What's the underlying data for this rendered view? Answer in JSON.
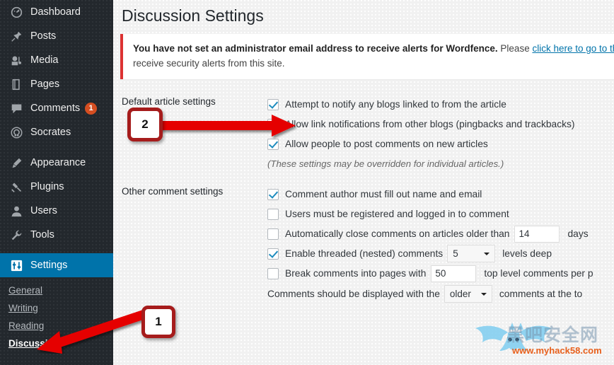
{
  "sidebar": {
    "items": [
      {
        "label": "Dashboard",
        "icon": "dashboard-icon",
        "name": "dashboard"
      },
      {
        "label": "Posts",
        "icon": "pin-icon",
        "name": "posts"
      },
      {
        "label": "Media",
        "icon": "media-icon",
        "name": "media"
      },
      {
        "label": "Pages",
        "icon": "pages-icon",
        "name": "pages"
      },
      {
        "label": "Comments",
        "icon": "comment-bubble-icon",
        "name": "comments",
        "badge": "1"
      },
      {
        "label": "Socrates",
        "icon": "omega-icon",
        "name": "socrates"
      },
      {
        "label": "Appearance",
        "icon": "brush-icon",
        "name": "appearance"
      },
      {
        "label": "Plugins",
        "icon": "plug-icon",
        "name": "plugins"
      },
      {
        "label": "Users",
        "icon": "user-icon",
        "name": "users"
      },
      {
        "label": "Tools",
        "icon": "wrench-icon",
        "name": "tools"
      },
      {
        "label": "Settings",
        "icon": "settings-sliders-icon",
        "name": "settings",
        "active": true
      }
    ],
    "submenu": [
      {
        "label": "General",
        "name": "general"
      },
      {
        "label": "Writing",
        "name": "writing"
      },
      {
        "label": "Reading",
        "name": "reading"
      },
      {
        "label": "Discussion",
        "name": "discussion",
        "current": true
      }
    ]
  },
  "page": {
    "title": "Discussion Settings"
  },
  "notice": {
    "bold_text": "You have not set an administrator email address to receive alerts for Wordfence.",
    "text_before_link": " Please ",
    "link_text": "click here to go to th",
    "text_after": "receive security alerts from this site."
  },
  "sections": [
    {
      "name": "default-article-settings",
      "label": "Default article settings",
      "checkboxes": [
        {
          "label": "Attempt to notify any blogs linked to from the article",
          "checked": true,
          "name": "notify-linked-blogs"
        },
        {
          "label": "Allow link notifications from other blogs (pingbacks and trackbacks)",
          "checked": true,
          "name": "allow-pingbacks"
        },
        {
          "label": "Allow people to post comments on new articles",
          "checked": true,
          "name": "allow-comments-new-articles"
        }
      ],
      "hint": "(These settings may be overridden for individual articles.)"
    },
    {
      "name": "other-comment-settings",
      "label": "Other comment settings",
      "rows": [
        {
          "type": "check",
          "label": "Comment author must fill out name and email",
          "checked": true,
          "name": "require-name-email"
        },
        {
          "type": "check",
          "label": "Users must be registered and logged in to comment",
          "checked": false,
          "name": "require-registration"
        },
        {
          "type": "check-input",
          "label": "Automatically close comments on articles older than",
          "checked": false,
          "value": "14",
          "suffix": "days",
          "name": "close-comments-days"
        },
        {
          "type": "check-select",
          "label": "Enable threaded (nested) comments",
          "checked": true,
          "value": "5",
          "suffix": "levels deep",
          "name": "threaded-comments-depth"
        },
        {
          "type": "check-input",
          "label": "Break comments into pages with",
          "checked": false,
          "value": "50",
          "suffix": "top level comments per p",
          "name": "comments-per-page"
        },
        {
          "type": "select-line",
          "prefix": "Comments should be displayed with the",
          "value": "older",
          "suffix": "comments at the to",
          "name": "comment-order"
        }
      ]
    }
  ],
  "annotations": [
    {
      "number": "1",
      "name": "callout-1"
    },
    {
      "number": "2",
      "name": "callout-2"
    }
  ],
  "watermark": {
    "cn_text": "黑吧安全网",
    "url": "www.myhack58.com"
  },
  "colors": {
    "sidebar_bg": "#23282d",
    "active_blue": "#0073aa",
    "badge_orange": "#d54e21",
    "notice_red": "#dc3232",
    "link_blue": "#0073aa",
    "check_blue": "#1e8cbe",
    "callout_red": "#a61c1c"
  }
}
